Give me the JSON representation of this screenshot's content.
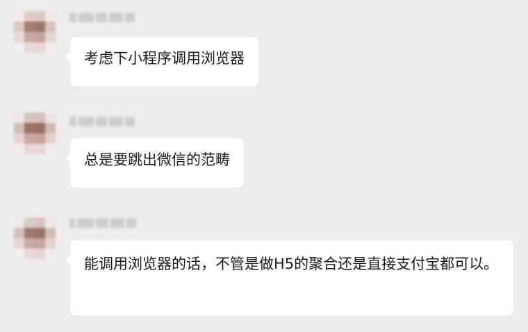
{
  "chat": {
    "messages": [
      {
        "text": "考虑下小程序调用浏览器"
      },
      {
        "text": "总是要跳出微信的范畴"
      },
      {
        "text": "能调用浏览器的话，不管是做H5的聚合还是直接支付宝都可以。"
      }
    ]
  },
  "colors": {
    "background": "#ededed",
    "bubble": "#ffffff",
    "text": "#1a1a1a"
  }
}
